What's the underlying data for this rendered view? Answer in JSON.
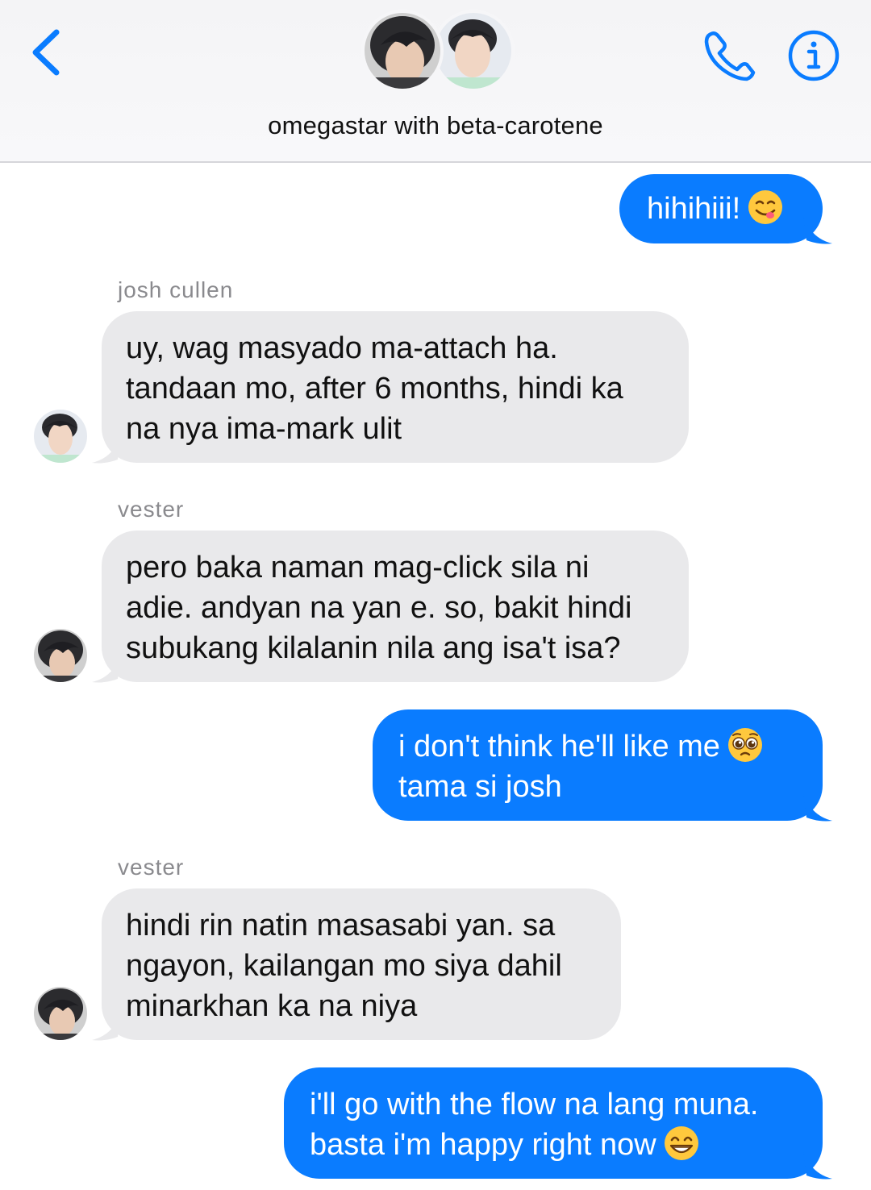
{
  "header": {
    "title": "omegastar with beta-carotene",
    "back_icon": "chevron-left-icon",
    "call_icon": "phone-icon",
    "info_icon": "info-icon",
    "accent_color": "#0a7cff"
  },
  "messages": [
    {
      "direction": "outgoing",
      "lines": [
        "hihihiii!"
      ],
      "emoji": "face-savoring-food"
    },
    {
      "direction": "incoming",
      "sender": "josh cullen",
      "lines": [
        "uy, wag masyado ma-attach ha.",
        "tandaan mo, after 6 months, hindi ka",
        "na nya ima-mark ulit"
      ]
    },
    {
      "direction": "incoming",
      "sender": "vester",
      "lines": [
        "pero baka naman mag-click sila ni",
        "adie. andyan na yan e. so, bakit hindi",
        "subukang kilalanin nila ang isa't isa?"
      ]
    },
    {
      "direction": "outgoing",
      "lines": [
        "i don't think he'll like me",
        "tama si josh"
      ],
      "emoji": "pleading-face"
    },
    {
      "direction": "incoming",
      "sender": "vester",
      "lines": [
        "hindi rin natin masasabi yan. sa",
        "ngayon, kailangan mo siya dahil",
        "minarkhan ka na niya"
      ]
    },
    {
      "direction": "outgoing",
      "lines": [
        "i'll go with the flow na lang muna.",
        "basta i'm happy right now"
      ],
      "emoji": "grinning-face"
    }
  ],
  "colors": {
    "outgoing_bubble": "#0a7cff",
    "incoming_bubble": "#e9e9eb",
    "sender_name": "#8a8a8e"
  }
}
